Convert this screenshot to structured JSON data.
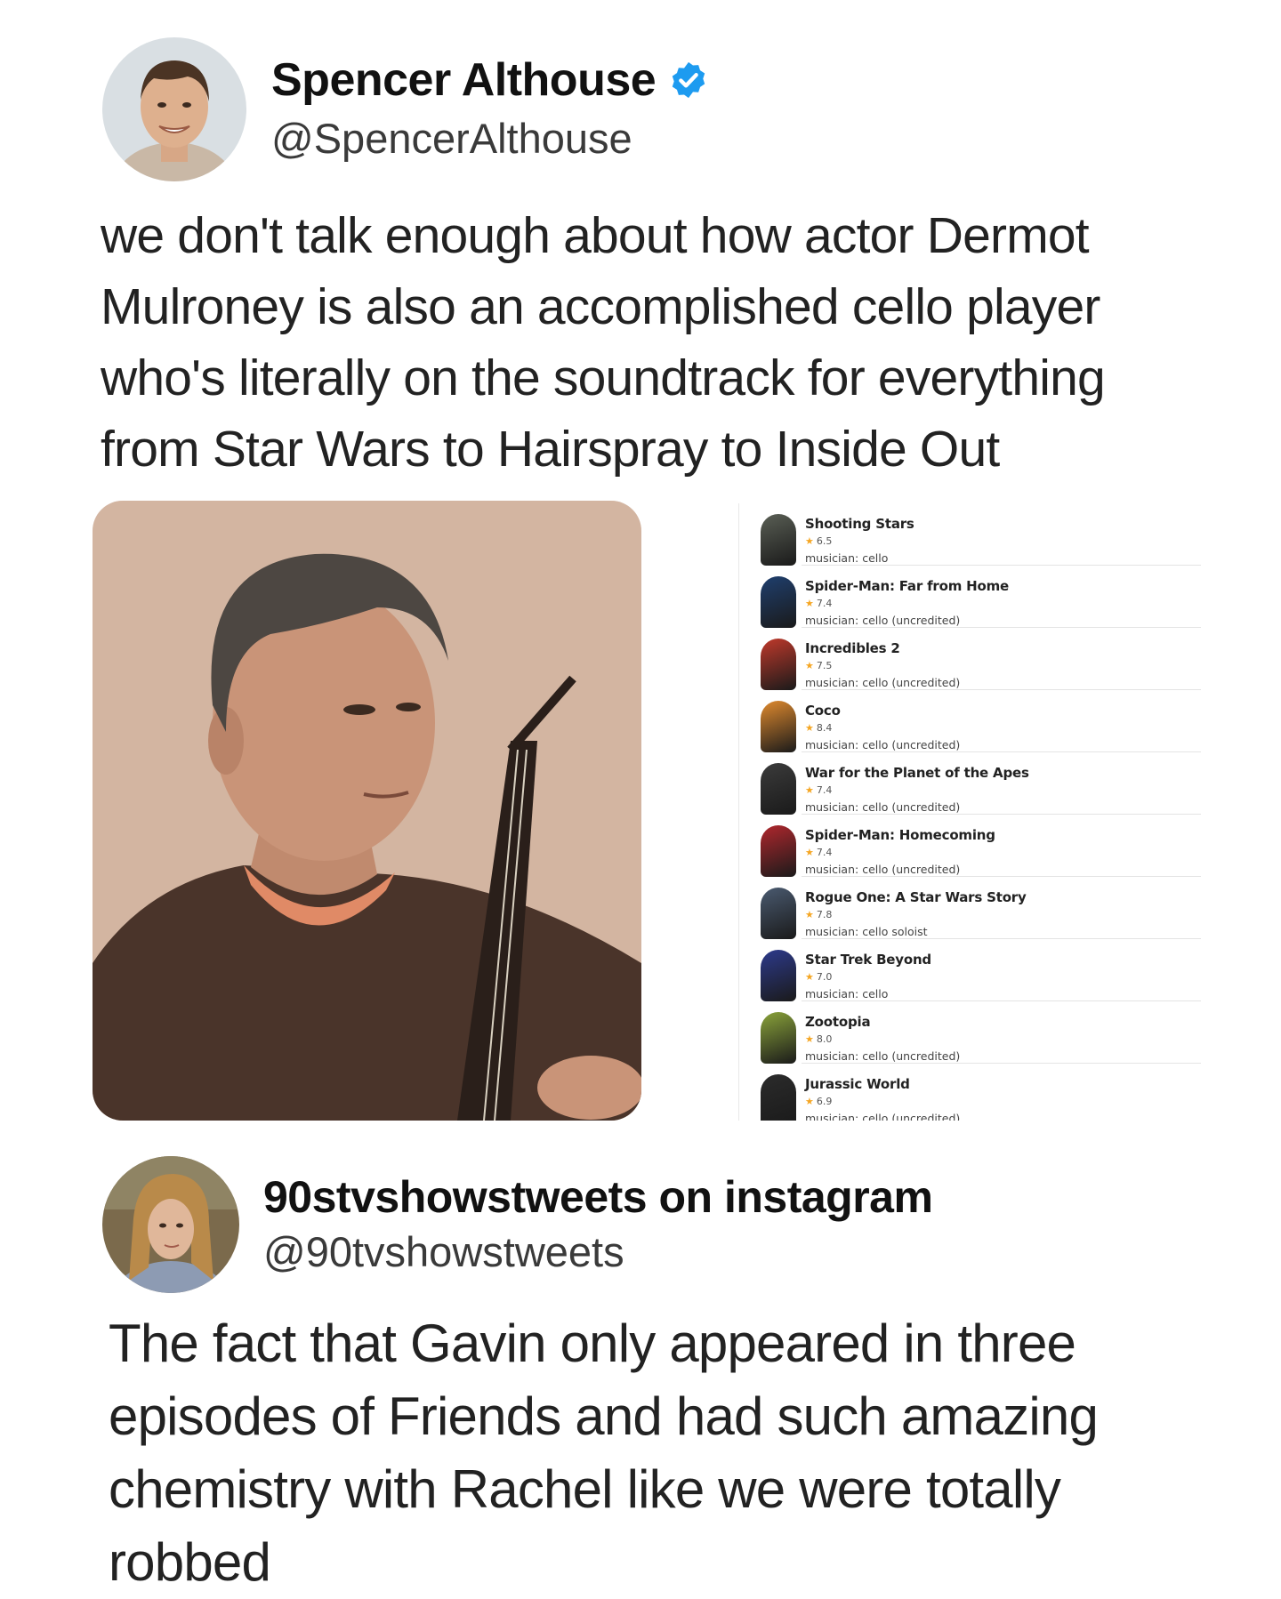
{
  "tweet1": {
    "name": "Spencer Althouse",
    "handle": "@SpencerAlthouse",
    "verified": true,
    "text_lines": [
      "we don't talk enough about how actor Dermot",
      "Mulroney is also an accomplished cello player",
      "who's literally on the soundtrack for everything",
      "from Star Wars to Hairspray to Inside Out"
    ],
    "credits": [
      {
        "title": "Shooting Stars",
        "rating": "6.5",
        "role": "musician: cello",
        "poster_color": "#5a5f55"
      },
      {
        "title": "Spider-Man: Far from Home",
        "rating": "7.4",
        "role": "musician: cello (uncredited)",
        "poster_color": "#1f3f6e"
      },
      {
        "title": "Incredibles 2",
        "rating": "7.5",
        "role": "musician: cello (uncredited)",
        "poster_color": "#c0392b"
      },
      {
        "title": "Coco",
        "rating": "8.4",
        "role": "musician: cello (uncredited)",
        "poster_color": "#e08a2e"
      },
      {
        "title": "War for the Planet of the Apes",
        "rating": "7.4",
        "role": "musician: cello (uncredited)",
        "poster_color": "#3b3b3b"
      },
      {
        "title": "Spider-Man: Homecoming",
        "rating": "7.4",
        "role": "musician: cello (uncredited)",
        "poster_color": "#b0272d"
      },
      {
        "title": "Rogue One: A Star Wars Story",
        "rating": "7.8",
        "role": "musician: cello soloist",
        "poster_color": "#4a5a70"
      },
      {
        "title": "Star Trek Beyond",
        "rating": "7.0",
        "role": "musician: cello",
        "poster_color": "#2d3a8c"
      },
      {
        "title": "Zootopia",
        "rating": "8.0",
        "role": "musician: cello (uncredited)",
        "poster_color": "#8aa33a"
      },
      {
        "title": "Jurassic World",
        "rating": "6.9",
        "role": "musician: cello (uncredited)",
        "poster_color": "#2b2b2b"
      }
    ]
  },
  "tweet2": {
    "name": "90stvshowstweets on instagram",
    "handle": "@90tvshowstweets",
    "text_lines": [
      "The fact that Gavin only appeared in three",
      "episodes of Friends and had such amazing",
      "chemistry with Rachel like we were totally",
      "robbed"
    ]
  },
  "colors": {
    "verified_blue": "#1d9bf0",
    "rating_star": "#f5a623",
    "photo_bg": "#d6b9a6",
    "shirt_brown": "#4a342a",
    "collar_orange": "#e08a66"
  }
}
